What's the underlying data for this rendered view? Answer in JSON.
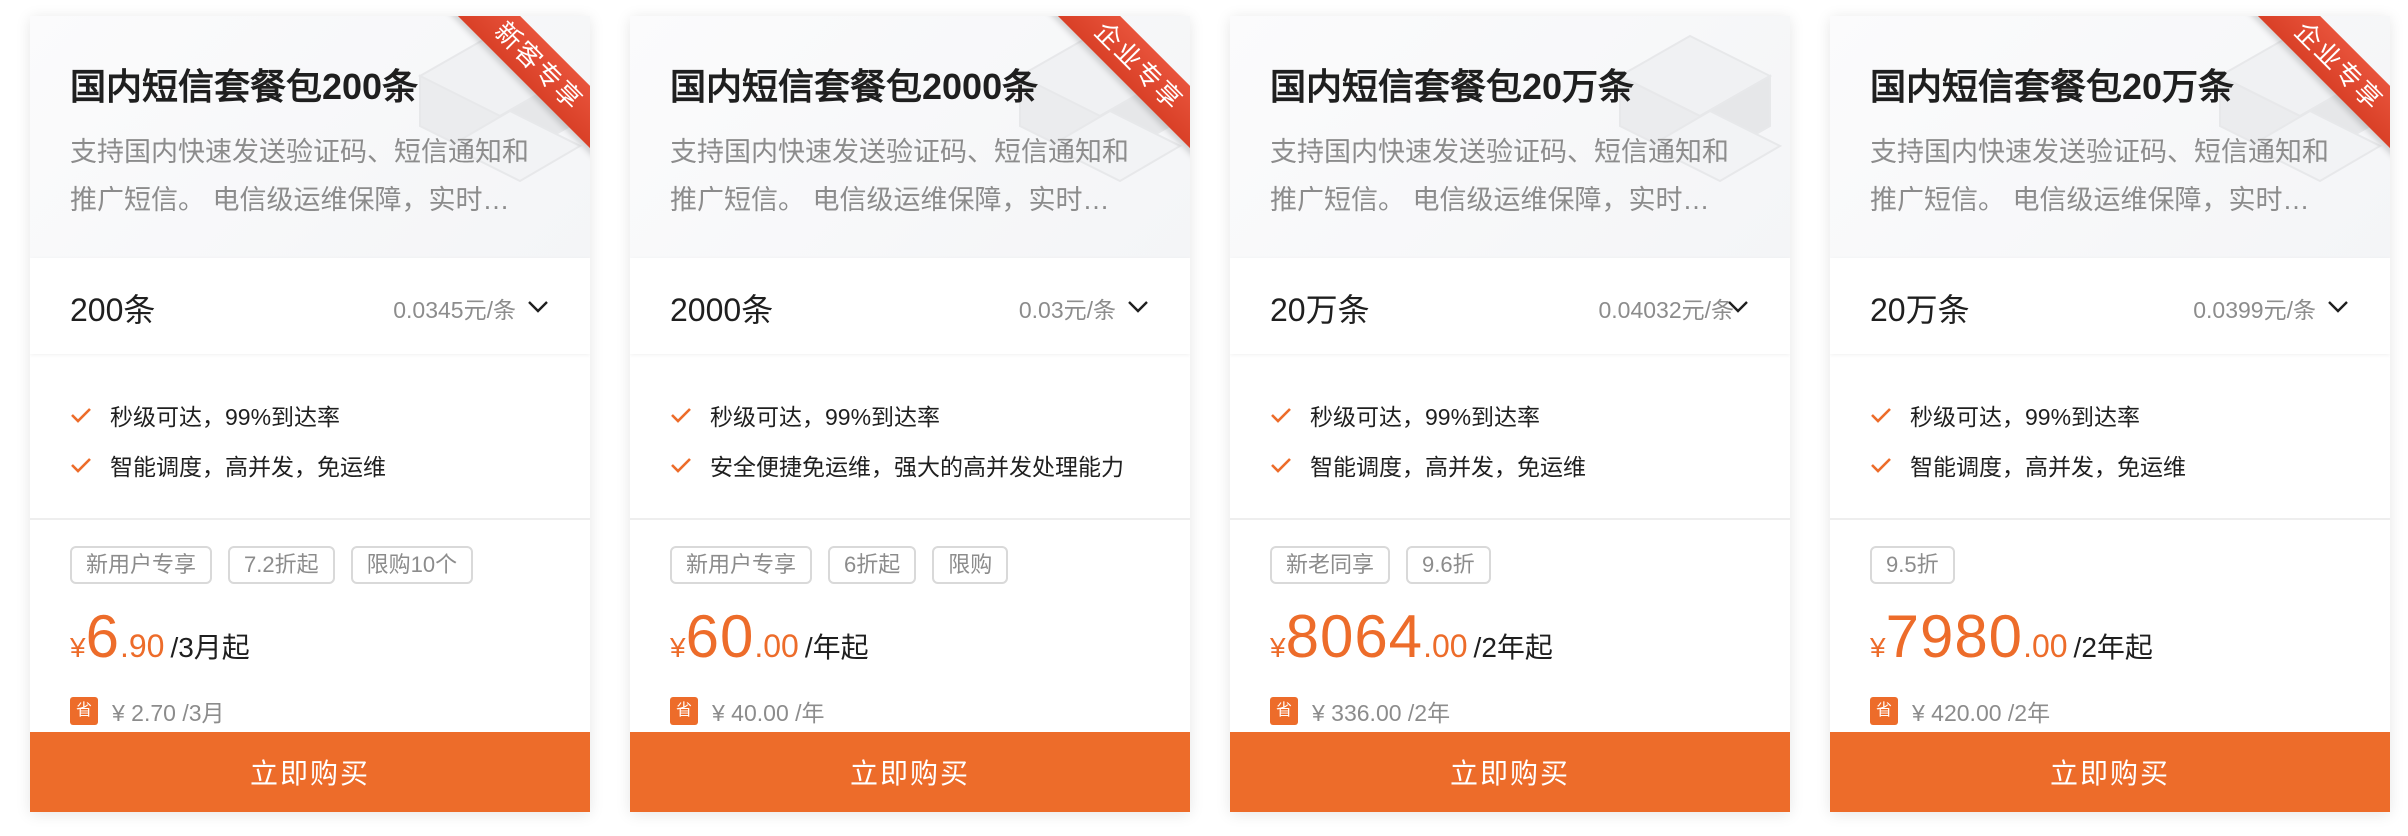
{
  "products": [
    {
      "ribbon": "新客专享",
      "title": "国内短信套餐包200条",
      "description": "支持国内快速发送验证码、短信通知和推广短信。 电信级运维保障，实时…",
      "quantity": "200条",
      "unit_price": "0.0345元/条",
      "features": [
        "秒级可达，99%到达率",
        "智能调度，高并发，免运维"
      ],
      "tags": [
        "新用户专享",
        "7.2折起",
        "限购10个"
      ],
      "price": {
        "currency": "¥",
        "integer": "6",
        "decimal": ".90",
        "period": "/3月起"
      },
      "save_badge": "省",
      "savings": "¥ 2.70 /3月",
      "button": "立即购买"
    },
    {
      "ribbon": "企业专享",
      "title": "国内短信套餐包2000条",
      "description": "支持国内快速发送验证码、短信通知和推广短信。 电信级运维保障，实时…",
      "quantity": "2000条",
      "unit_price": "0.03元/条",
      "features": [
        "秒级可达，99%到达率",
        "安全便捷免运维，强大的高并发处理能力"
      ],
      "tags": [
        "新用户专享",
        "6折起",
        "限购"
      ],
      "price": {
        "currency": "¥",
        "integer": "60",
        "decimal": ".00",
        "period": "/年起"
      },
      "save_badge": "省",
      "savings": "¥ 40.00 /年",
      "button": "立即购买"
    },
    {
      "ribbon": "",
      "title": "国内短信套餐包20万条",
      "description": "支持国内快速发送验证码、短信通知和推广短信。 电信级运维保障，实时…",
      "quantity": "20万条",
      "unit_price": "0.04032元/条",
      "features": [
        "秒级可达，99%到达率",
        "智能调度，高并发，免运维"
      ],
      "tags": [
        "新老同享",
        "9.6折"
      ],
      "price": {
        "currency": "¥",
        "integer": "8064",
        "decimal": ".00",
        "period": "/2年起"
      },
      "save_badge": "省",
      "savings": "¥ 336.00 /2年",
      "button": "立即购买"
    },
    {
      "ribbon": "企业专享",
      "title": "国内短信套餐包20万条",
      "description": "支持国内快速发送验证码、短信通知和推广短信。 电信级运维保障，实时…",
      "quantity": "20万条",
      "unit_price": "0.0399元/条",
      "features": [
        "秒级可达，99%到达率",
        "智能调度，高并发，免运维"
      ],
      "tags": [
        "9.5折"
      ],
      "price": {
        "currency": "¥",
        "integer": "7980",
        "decimal": ".00",
        "period": "/2年起"
      },
      "save_badge": "省",
      "savings": "¥ 420.00 /2年",
      "button": "立即购买"
    }
  ],
  "colors": {
    "accent": "#ed6c2a",
    "ribbon": "#e04a31",
    "muted": "#8c8c8c"
  },
  "icons": {
    "check": "check-icon",
    "dropdown": "chevron-down-icon",
    "decoration": "isometric-decoration"
  }
}
